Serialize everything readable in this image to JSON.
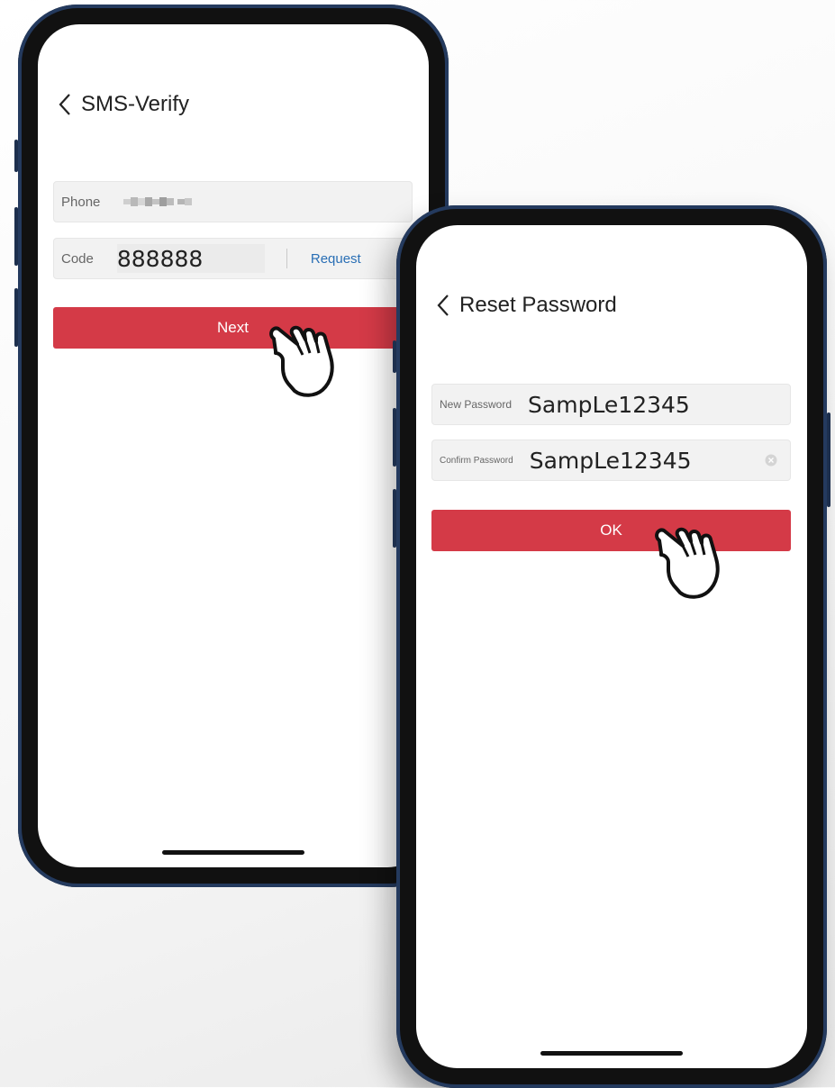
{
  "sms_screen": {
    "title": "SMS-Verify",
    "phone_label": "Phone",
    "code_label": "Code",
    "code_value": "888888",
    "request_label": "Request",
    "next_label": "Next"
  },
  "reset_screen": {
    "title": "Reset Password",
    "new_password_label": "New Password",
    "new_password_value": "SampLe12345",
    "confirm_password_label": "Confirm Password",
    "confirm_password_value": "SampLe12345",
    "ok_label": "OK"
  },
  "colors": {
    "accent": "#d43a47",
    "link": "#2a6fb5",
    "frame": "#243a5e"
  }
}
